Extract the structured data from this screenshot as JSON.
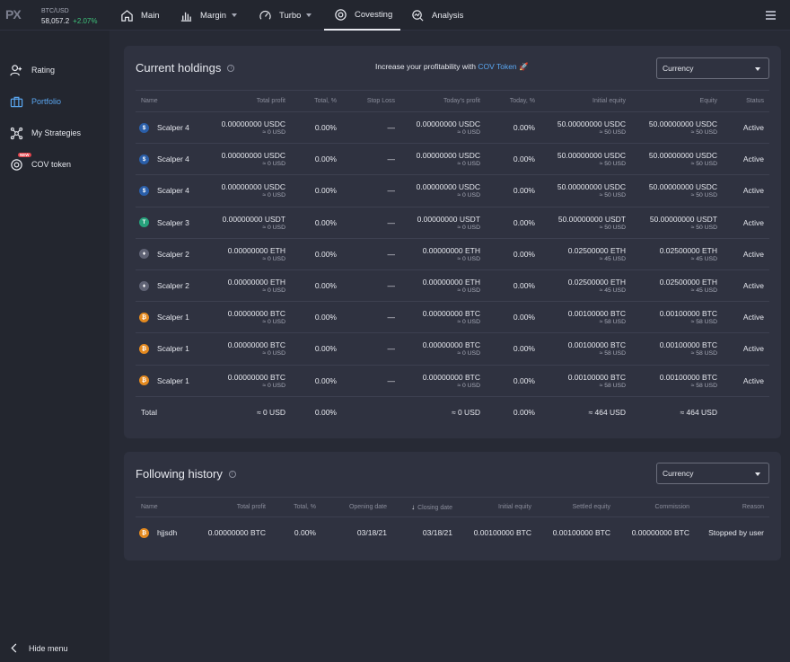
{
  "topbar": {
    "logo": "PX",
    "ticker": {
      "pair": "BTC/USD",
      "price": "58,057.2",
      "change": "+2.07%"
    },
    "nav": [
      {
        "label": "Main",
        "icon": "home-icon"
      },
      {
        "label": "Margin",
        "icon": "bar-chart-icon"
      },
      {
        "label": "Turbo",
        "icon": "speedometer-icon"
      },
      {
        "label": "Covesting",
        "icon": "covesting-icon"
      },
      {
        "label": "Analysis",
        "icon": "analysis-icon"
      }
    ]
  },
  "sidebar": {
    "items": [
      {
        "label": "Rating",
        "icon": "user-plus-icon"
      },
      {
        "label": "Portfolio",
        "icon": "briefcase-icon"
      },
      {
        "label": "My Strategies",
        "icon": "strategies-icon"
      },
      {
        "label": "COV token",
        "icon": "cov-token-icon",
        "badge": "NEW"
      }
    ],
    "hide_menu": "Hide menu"
  },
  "holdings": {
    "title": "Current holdings",
    "promo_text": "Increase your profitability with",
    "promo_link": "COV Token",
    "currency_select": "Currency",
    "columns": [
      "Name",
      "Total profit",
      "Total, %",
      "Stop Loss",
      "Today's profit",
      "Today, %",
      "Initial equity",
      "Equity",
      "Status"
    ],
    "rows": [
      {
        "coin": "usdc",
        "name": "Scalper 4",
        "total_profit": "0.00000000 USDC",
        "total_profit_usd": "≈ 0 USD",
        "total_pct": "0.00%",
        "stop_loss": "—",
        "today_profit": "0.00000000 USDC",
        "today_profit_usd": "≈ 0 USD",
        "today_pct": "0.00%",
        "initial_equity": "50.00000000 USDC",
        "initial_equity_usd": "≈ 50 USD",
        "equity": "50.00000000 USDC",
        "equity_usd": "≈ 50 USD",
        "status": "Active"
      },
      {
        "coin": "usdc",
        "name": "Scalper 4",
        "total_profit": "0.00000000 USDC",
        "total_profit_usd": "≈ 0 USD",
        "total_pct": "0.00%",
        "stop_loss": "—",
        "today_profit": "0.00000000 USDC",
        "today_profit_usd": "≈ 0 USD",
        "today_pct": "0.00%",
        "initial_equity": "50.00000000 USDC",
        "initial_equity_usd": "≈ 50 USD",
        "equity": "50.00000000 USDC",
        "equity_usd": "≈ 50 USD",
        "status": "Active"
      },
      {
        "coin": "usdc",
        "name": "Scalper 4",
        "total_profit": "0.00000000 USDC",
        "total_profit_usd": "≈ 0 USD",
        "total_pct": "0.00%",
        "stop_loss": "—",
        "today_profit": "0.00000000 USDC",
        "today_profit_usd": "≈ 0 USD",
        "today_pct": "0.00%",
        "initial_equity": "50.00000000 USDC",
        "initial_equity_usd": "≈ 50 USD",
        "equity": "50.00000000 USDC",
        "equity_usd": "≈ 50 USD",
        "status": "Active"
      },
      {
        "coin": "usdt",
        "name": "Scalper 3",
        "total_profit": "0.00000000 USDT",
        "total_profit_usd": "≈ 0 USD",
        "total_pct": "0.00%",
        "stop_loss": "—",
        "today_profit": "0.00000000 USDT",
        "today_profit_usd": "≈ 0 USD",
        "today_pct": "0.00%",
        "initial_equity": "50.00000000 USDT",
        "initial_equity_usd": "≈ 50 USD",
        "equity": "50.00000000 USDT",
        "equity_usd": "≈ 50 USD",
        "status": "Active"
      },
      {
        "coin": "eth",
        "name": "Scalper 2",
        "total_profit": "0.00000000 ETH",
        "total_profit_usd": "≈ 0 USD",
        "total_pct": "0.00%",
        "stop_loss": "—",
        "today_profit": "0.00000000 ETH",
        "today_profit_usd": "≈ 0 USD",
        "today_pct": "0.00%",
        "initial_equity": "0.02500000 ETH",
        "initial_equity_usd": "≈ 45 USD",
        "equity": "0.02500000 ETH",
        "equity_usd": "≈ 45 USD",
        "status": "Active"
      },
      {
        "coin": "eth",
        "name": "Scalper 2",
        "total_profit": "0.00000000 ETH",
        "total_profit_usd": "≈ 0 USD",
        "total_pct": "0.00%",
        "stop_loss": "—",
        "today_profit": "0.00000000 ETH",
        "today_profit_usd": "≈ 0 USD",
        "today_pct": "0.00%",
        "initial_equity": "0.02500000 ETH",
        "initial_equity_usd": "≈ 45 USD",
        "equity": "0.02500000 ETH",
        "equity_usd": "≈ 45 USD",
        "status": "Active"
      },
      {
        "coin": "btc",
        "name": "Scalper 1",
        "total_profit": "0.00000000 BTC",
        "total_profit_usd": "≈ 0 USD",
        "total_pct": "0.00%",
        "stop_loss": "—",
        "today_profit": "0.00000000 BTC",
        "today_profit_usd": "≈ 0 USD",
        "today_pct": "0.00%",
        "initial_equity": "0.00100000 BTC",
        "initial_equity_usd": "≈ 58 USD",
        "equity": "0.00100000 BTC",
        "equity_usd": "≈ 58 USD",
        "status": "Active"
      },
      {
        "coin": "btc",
        "name": "Scalper 1",
        "total_profit": "0.00000000 BTC",
        "total_profit_usd": "≈ 0 USD",
        "total_pct": "0.00%",
        "stop_loss": "—",
        "today_profit": "0.00000000 BTC",
        "today_profit_usd": "≈ 0 USD",
        "today_pct": "0.00%",
        "initial_equity": "0.00100000 BTC",
        "initial_equity_usd": "≈ 58 USD",
        "equity": "0.00100000 BTC",
        "equity_usd": "≈ 58 USD",
        "status": "Active"
      },
      {
        "coin": "btc",
        "name": "Scalper 1",
        "total_profit": "0.00000000 BTC",
        "total_profit_usd": "≈ 0 USD",
        "total_pct": "0.00%",
        "stop_loss": "—",
        "today_profit": "0.00000000 BTC",
        "today_profit_usd": "≈ 0 USD",
        "today_pct": "0.00%",
        "initial_equity": "0.00100000 BTC",
        "initial_equity_usd": "≈ 58 USD",
        "equity": "0.00100000 BTC",
        "equity_usd": "≈ 58 USD",
        "status": "Active"
      }
    ],
    "total": {
      "label": "Total",
      "total_profit": "≈ 0 USD",
      "total_pct": "0.00%",
      "today_profit": "≈ 0 USD",
      "today_pct": "0.00%",
      "initial_equity": "≈ 464 USD",
      "equity": "≈ 464 USD"
    }
  },
  "history": {
    "title": "Following history",
    "currency_select": "Currency",
    "columns": [
      "Name",
      "Total profit",
      "Total, %",
      "Opening date",
      "Closing date",
      "Initial equity",
      "Settled equity",
      "Commission",
      "Reason"
    ],
    "rows": [
      {
        "coin": "btc",
        "name": "hjjsdh",
        "total_profit": "0.00000000 BTC",
        "total_pct": "0.00%",
        "opening_date": "03/18/21",
        "closing_date": "03/18/21",
        "initial_equity": "0.00100000 BTC",
        "settled_equity": "0.00100000 BTC",
        "commission": "0.00000000 BTC",
        "reason": "Stopped by user"
      }
    ]
  },
  "colors": {
    "background": "#272a35",
    "panel": "#2f3240",
    "accent": "#5aa6f0",
    "positive": "#3ec27a",
    "usdc": "#2a5ea8",
    "usdt": "#26a17b",
    "eth": "#5f6274",
    "btc": "#e3891f"
  }
}
